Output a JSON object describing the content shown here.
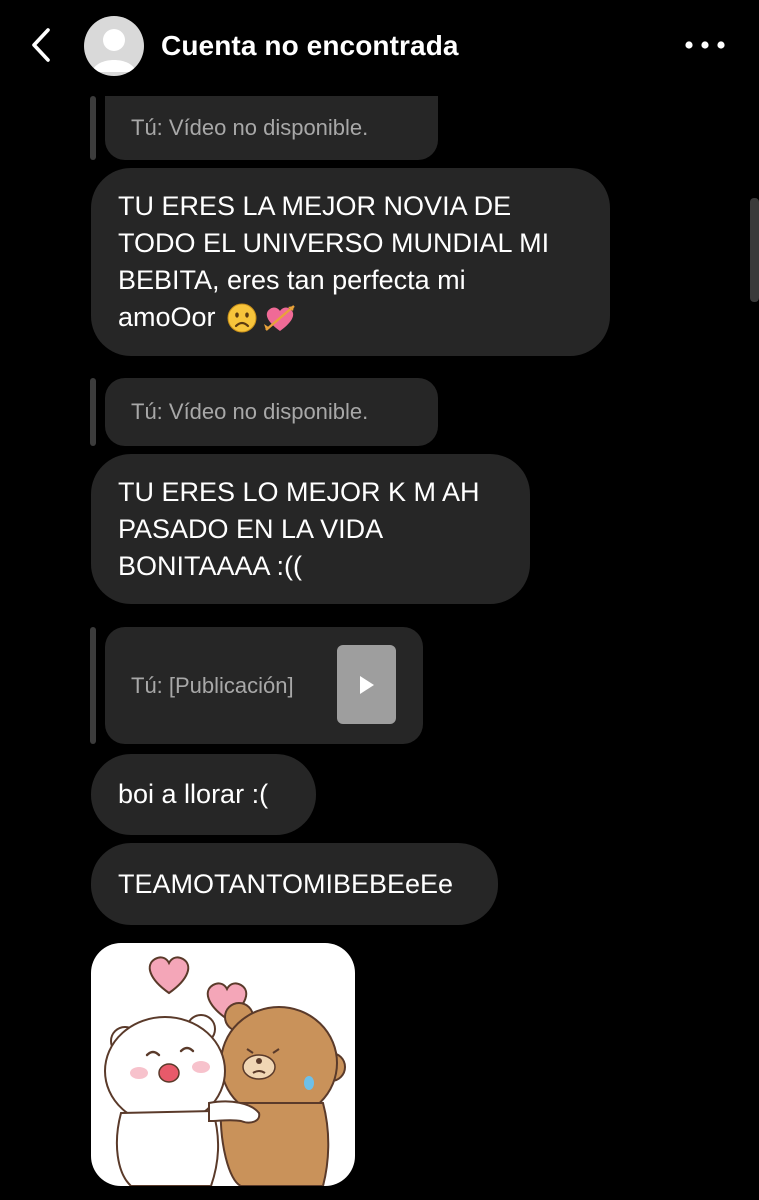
{
  "header": {
    "title": "Cuenta no encontrada",
    "back_icon": "chevron-left-icon",
    "more_icon": "more-horizontal-icon"
  },
  "messages": [
    {
      "type": "reply",
      "text": "Tú: Vídeo no disponible."
    },
    {
      "type": "text",
      "lines": [
        "TU ERES LA MEJOR NOVIA DE",
        "TODO EL UNIVERSO MUNDIAL MI",
        "BEBITA, eres tan perfecta mi",
        "amoOor"
      ],
      "emoji": [
        "☹",
        "💘"
      ]
    },
    {
      "type": "reply",
      "text": "Tú: Vídeo no disponible."
    },
    {
      "type": "text",
      "text": "TU ERES LO MEJOR K M AH\nPASADO EN LA VIDA\nBONITAAAA :(("
    },
    {
      "type": "reply",
      "text": "Tú: [Publicación]"
    },
    {
      "type": "text",
      "text": "boi a llorar :("
    },
    {
      "type": "text",
      "text": "TEAMOTANTOMIBEBEeEe"
    },
    {
      "type": "sticker",
      "description_icon": "bears-hug-sticker"
    }
  ],
  "colors": {
    "background": "#000000",
    "bubble": "#262626",
    "reply_text": "#a8a8a8",
    "text": "#ffffff"
  }
}
